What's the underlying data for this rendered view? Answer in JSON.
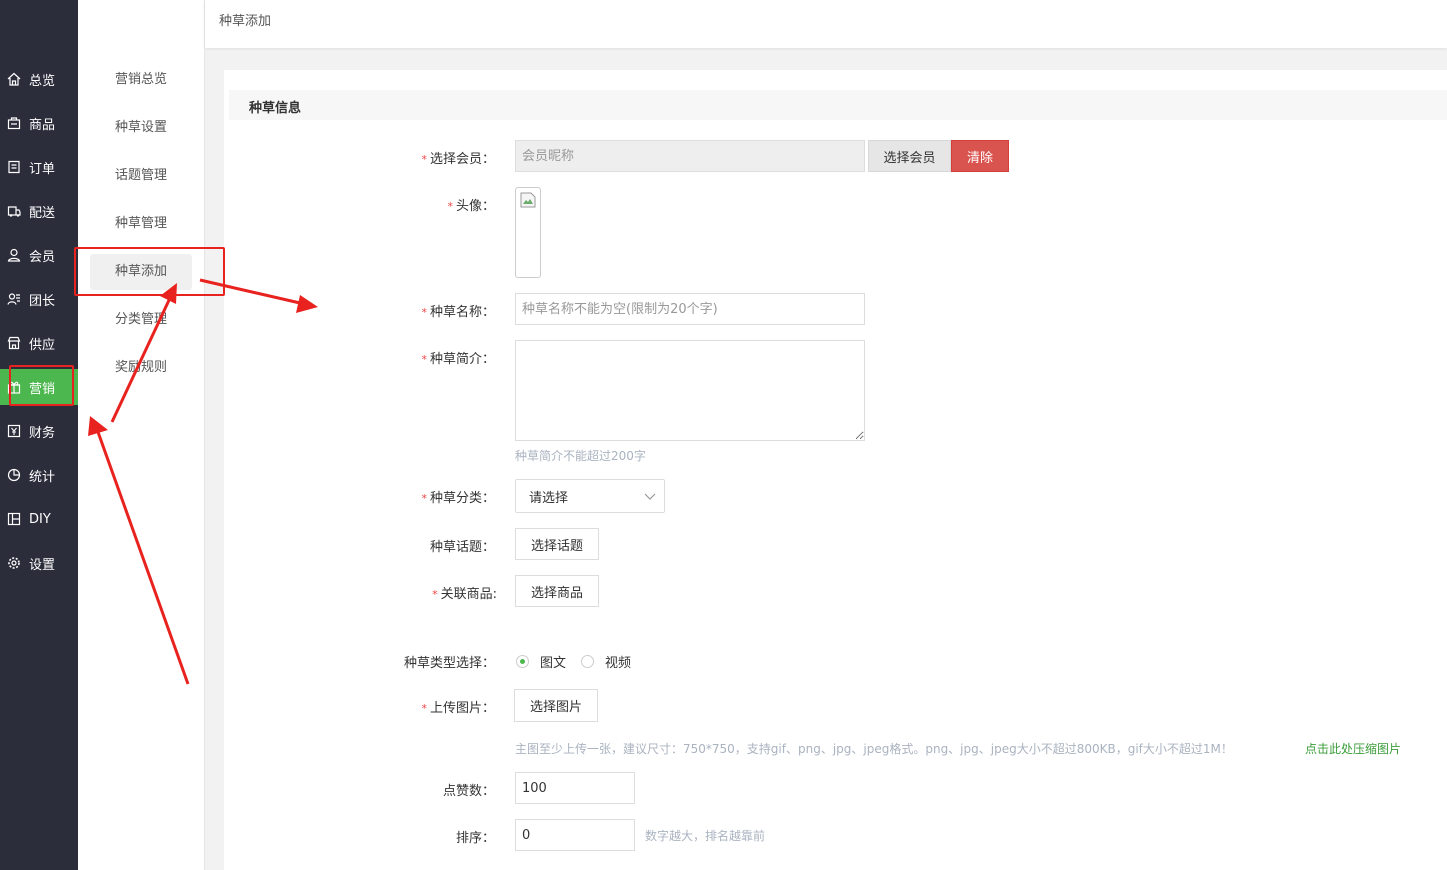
{
  "sidebar": {
    "items": [
      {
        "label": "总览",
        "icon": "home-icon"
      },
      {
        "label": "商品",
        "icon": "goods-icon"
      },
      {
        "label": "订单",
        "icon": "order-icon"
      },
      {
        "label": "配送",
        "icon": "delivery-icon"
      },
      {
        "label": "会员",
        "icon": "member-icon"
      },
      {
        "label": "团长",
        "icon": "leader-icon"
      },
      {
        "label": "供应",
        "icon": "supply-icon"
      },
      {
        "label": "营销",
        "icon": "marketing-icon",
        "active": true
      },
      {
        "label": "财务",
        "icon": "finance-icon"
      },
      {
        "label": "统计",
        "icon": "stats-icon"
      },
      {
        "label": "DIY",
        "icon": "diy-icon"
      },
      {
        "label": "设置",
        "icon": "gear-icon"
      }
    ]
  },
  "submenu": {
    "items": [
      {
        "label": "营销总览"
      },
      {
        "label": "种草设置"
      },
      {
        "label": "话题管理"
      },
      {
        "label": "种草管理"
      },
      {
        "label": "种草添加",
        "active": true
      },
      {
        "label": "分类管理"
      },
      {
        "label": "奖励规则"
      }
    ]
  },
  "breadcrumb": {
    "title": "种草添加"
  },
  "form": {
    "section_title": "种草信息",
    "member": {
      "label": "选择会员：",
      "placeholder": "会员昵称",
      "select_button": "选择会员",
      "clear_button": "清除"
    },
    "avatar": {
      "label": "头像："
    },
    "name": {
      "label": "种草名称：",
      "placeholder": "种草名称不能为空(限制为20个字)"
    },
    "intro": {
      "label": "种草简介：",
      "hint": "种草简介不能超过200字"
    },
    "category": {
      "label": "种草分类：",
      "selected": "请选择"
    },
    "topic": {
      "label": "种草话题：",
      "button": "选择话题"
    },
    "product": {
      "label": "关联商品:",
      "button": "选择商品"
    },
    "type": {
      "label": "种草类型选择：",
      "options": [
        "图文",
        "视频"
      ],
      "selected": "图文"
    },
    "upload": {
      "label": "上传图片：",
      "button": "选择图片",
      "hint": "主图至少上传一张，建议尺寸：750*750，支持gif、png、jpg、jpeg格式。png、jpg、jpeg大小不超过800KB，gif大小不超过1M！",
      "compress_link": "点击此处压缩图片"
    },
    "likes": {
      "label": "点赞数：",
      "value": "100"
    },
    "sort": {
      "label": "排序：",
      "value": "0",
      "hint": "数字越大，排名越靠前"
    }
  },
  "colors": {
    "accent": "#4bb74e",
    "danger": "#d9534f",
    "sidebar_bg": "#2b2d3b",
    "annotation": "#e8231f"
  }
}
